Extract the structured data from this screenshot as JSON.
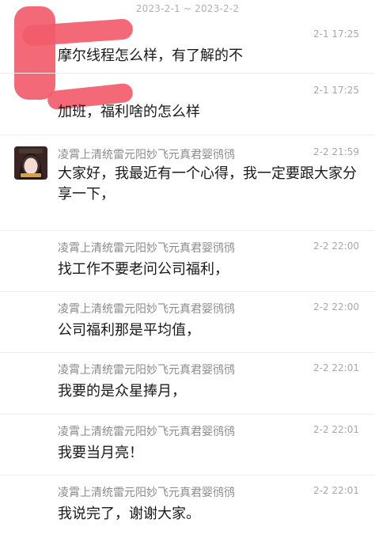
{
  "header": {
    "date_range": "2023-2-1 ~ 2023-2-2"
  },
  "messages": [
    {
      "sender": "",
      "time": "2-1 17:25",
      "text": "摩尔线程怎么样，有了解的不",
      "sender_redacted": true
    },
    {
      "sender": "",
      "time": "2-1 17:25",
      "text": "加班，福利啥的怎么样",
      "sender_redacted": true
    },
    {
      "sender": "凌霄上清统雷元阳妙飞元真君婴鸻鸻",
      "time": "2-2 21:59",
      "text": "大家好，我最近有一个心得，我一定要跟大家分享一下，",
      "avatar": true
    },
    {
      "sender": "凌霄上清统雷元阳妙飞元真君婴鸻鸻",
      "time": "2-2 22:00",
      "text": "找工作不要老问公司福利，"
    },
    {
      "sender": "凌霄上清统雷元阳妙飞元真君婴鸻鸻",
      "time": "2-2 22:00",
      "text": "公司福利那是平均值，"
    },
    {
      "sender": "凌霄上清统雷元阳妙飞元真君婴鸻鸻",
      "time": "2-2 22:01",
      "text": "我要的是众星捧月，"
    },
    {
      "sender": "凌霄上清统雷元阳妙飞元真君婴鸻鸻",
      "time": "2-2 22:01",
      "text": "我要当月亮！"
    },
    {
      "sender": "凌霄上清统雷元阳妙飞元真君婴鸻鸻",
      "time": "2-2 22:01",
      "text": "我说完了，谢谢大家。"
    }
  ],
  "colors": {
    "redaction": "#f25c6b",
    "text": "#1a1a1a",
    "meta": "#8a8a8a"
  }
}
